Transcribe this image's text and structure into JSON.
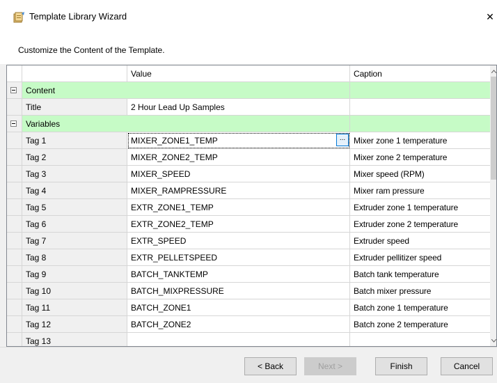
{
  "window": {
    "title": "Template Library Wizard",
    "close_glyph": "✕",
    "subtitle": "Customize the Content of the Template."
  },
  "grid": {
    "columns": {
      "value": "Value",
      "caption": "Caption"
    },
    "categories": [
      {
        "name": "Content"
      },
      {
        "name": "Variables"
      }
    ],
    "title_row": {
      "name": "Title",
      "value": "2 Hour Lead Up Samples",
      "caption": ""
    },
    "tags": [
      {
        "name": "Tag 1",
        "value": "MIXER_ZONE1_TEMP",
        "caption": "Mixer zone 1 temperature"
      },
      {
        "name": "Tag 2",
        "value": "MIXER_ZONE2_TEMP",
        "caption": "Mixer zone 2 temperature"
      },
      {
        "name": "Tag 3",
        "value": "MIXER_SPEED",
        "caption": "Mixer speed (RPM)"
      },
      {
        "name": "Tag 4",
        "value": "MIXER_RAMPRESSURE",
        "caption": "Mixer ram pressure"
      },
      {
        "name": "Tag 5",
        "value": "EXTR_ZONE1_TEMP",
        "caption": "Extruder zone 1 temperature"
      },
      {
        "name": "Tag 6",
        "value": "EXTR_ZONE2_TEMP",
        "caption": "Extruder zone 2 temperature"
      },
      {
        "name": "Tag 7",
        "value": "EXTR_SPEED",
        "caption": "Extruder speed"
      },
      {
        "name": "Tag 8",
        "value": "EXTR_PELLETSPEED",
        "caption": "Extruder pellitizer speed"
      },
      {
        "name": "Tag 9",
        "value": "BATCH_TANKTEMP",
        "caption": "Batch tank temperature"
      },
      {
        "name": "Tag 10",
        "value": "BATCH_MIXPRESSURE",
        "caption": "Batch mixer pressure"
      },
      {
        "name": "Tag 11",
        "value": "BATCH_ZONE1",
        "caption": "Batch zone 1 temperature"
      },
      {
        "name": "Tag 12",
        "value": "BATCH_ZONE2",
        "caption": "Batch zone 2 temperature"
      },
      {
        "name": "Tag 13",
        "value": "",
        "caption": ""
      }
    ],
    "ellipsis_label": "..."
  },
  "buttons": {
    "back": "< Back",
    "next": "Next >",
    "finish": "Finish",
    "cancel": "Cancel"
  },
  "colors": {
    "category_bg": "#c6fbc6",
    "selection_border": "#0078d7"
  },
  "icons": {
    "app": "wizard-icon",
    "close": "close-icon",
    "expand": "collapse-toggle-icon"
  }
}
